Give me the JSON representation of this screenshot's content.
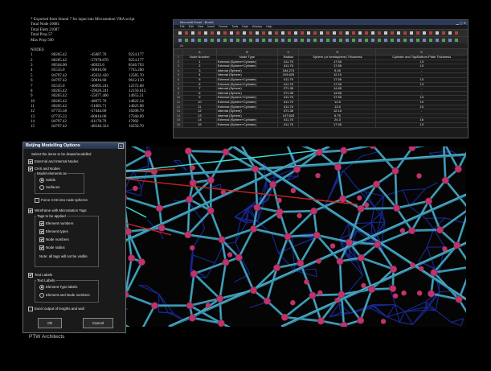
{
  "text_file": {
    "header_lines": [
      "* Exported from Strand 7 for input into Microstation VBA script",
      "Total Node      10681",
      "Total Elem      21087",
      "Total Prop      57",
      "Max Prop        500"
    ],
    "section_title": "NODES",
    "nodes": [
      [
        "1",
        "80265.42",
        "-45087.70",
        "9254.177"
      ],
      [
        "2",
        "80265.42",
        "-57078.670",
        "9254.177"
      ],
      [
        "3",
        "80504.00",
        "-46923.6",
        "8546.703"
      ],
      [
        "4",
        "85535.0",
        "-50816.60",
        "7745.260"
      ],
      [
        "5",
        "84797.42",
        "-45632.420",
        "12585.70"
      ],
      [
        "6",
        "84797.42",
        "-50816.60",
        "9612.150"
      ],
      [
        "7",
        "85535.0",
        "-46095.241",
        "12572.68"
      ],
      [
        "8",
        "80265.42",
        "-59620.241",
        "12150.612"
      ],
      [
        "9",
        "80265.42",
        "-55077.400",
        "14055.51"
      ],
      [
        "10",
        "80265.42",
        "-48075.70",
        "14822.54"
      ],
      [
        "11",
        "80265.42",
        "-51085.71",
        "14025.98"
      ],
      [
        "12",
        "87735.58",
        "-57444.60",
        "16200.79"
      ],
      [
        "13",
        "87735.22",
        "-60816.00",
        "17560.09"
      ],
      [
        "14",
        "84797.42",
        "-61178.79",
        "17092"
      ],
      [
        "15",
        "84797.42",
        "-48546.324",
        "16250.70"
      ]
    ]
  },
  "excel": {
    "title": "Microsoft Excel - Book1",
    "menu": [
      "File",
      "Edit",
      "View",
      "Insert",
      "Format",
      "Tools",
      "Data",
      "Window",
      "Help"
    ],
    "name_box": "A1",
    "columns": [
      "A",
      "B",
      "C",
      "D",
      "E"
    ],
    "headers": [
      "Node Number",
      "Node Type",
      "Radius",
      "Sphere (or hemisphere) Thickness",
      "Cylinder and Top/Bottom Plate Thickness"
    ],
    "rows": [
      [
        "1",
        "External (Sphere+Cylinder)",
        "411.75",
        "17.55",
        "13"
      ],
      [
        "2",
        "External (Sphere+Cylinder)",
        "411.75",
        "17.55",
        "13"
      ],
      [
        "3",
        "Internal (Sphere)",
        "184.273",
        "9.45",
        "-"
      ],
      [
        "4",
        "Internal (Sphere)",
        "219.625",
        "12.15",
        "-"
      ],
      [
        "5",
        "External (Sphere+Cylinder)",
        "411.75",
        "17.55",
        "13"
      ],
      [
        "6",
        "External (Sphere+Cylinder)",
        "411.75",
        "17.55",
        "13"
      ],
      [
        "7",
        "Internal (Sphere)",
        "271.35",
        "14.85",
        "-"
      ],
      [
        "8",
        "Internal (Sphere)",
        "271.35",
        "14.85",
        "-"
      ],
      [
        "9",
        "External (Sphere+Cylinder)",
        "411.75",
        "17.55",
        "13"
      ],
      [
        "10",
        "External (Sphere+Cylinder)",
        "411.75",
        "13.5",
        "10"
      ],
      [
        "11",
        "External (Sphere+Cylinder)",
        "411.75",
        "13.5",
        "10"
      ],
      [
        "12",
        "Internal (Sphere)",
        "271.35",
        "12.15",
        "-"
      ],
      [
        "13",
        "Internal (Sphere)",
        "147.625",
        "6.75",
        "-"
      ],
      [
        "14",
        "External (Sphere+Cylinder)",
        "411.75",
        "24.3",
        "16"
      ],
      [
        "15",
        "External (Sphere+Cylinder)",
        "411.75",
        "17.55",
        "13"
      ]
    ]
  },
  "dialog": {
    "title": "Beijing Modelling Options",
    "instruction": "Select the items to be drawn/modelled",
    "ext_int_nodes": "External and Internal Nodes",
    "chs_and_nodes": "CHS and Nodes",
    "model_elements_as": "Model elements as",
    "solids": "Solids",
    "surfaces": "Surfaces",
    "force_chs": "Force CHS into node spheres",
    "wireframe": "Wireframe with Microstation Tags",
    "tags_applied": "Tags to be applied",
    "element_numbers": "Element numbers",
    "element_types": "Element types",
    "node_numbers": "Node numbers",
    "node_radius": "Node radius",
    "note": "Note: all tags will not be visible",
    "text_labels": "Text Labels",
    "text_labels_sub": "Text Labels",
    "element_type_labels": "Element Type labels",
    "element_node_numbers": "Element and Node numbers",
    "excel_output": "Excel output of lengths and wall",
    "ok": "Ok",
    "cancel": "Cancel"
  },
  "credit": "PTW Architects",
  "colors": {
    "strut": "#2f8aa6",
    "strut_light": "#5fb6cc",
    "node": "#c0336a",
    "back": "#1a2a9a",
    "callout_red": "#d02020",
    "callout_cyan": "#3ee0d8"
  }
}
